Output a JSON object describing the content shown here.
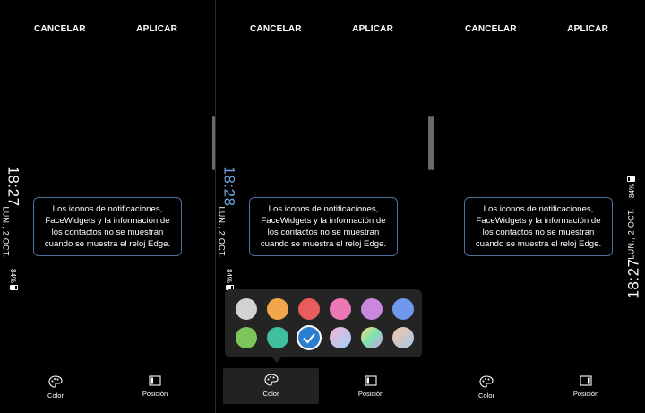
{
  "header": {
    "cancel_label": "CANCELAR",
    "apply_label": "APLICAR"
  },
  "notice_text": "Los iconos de notificaciones,\nFaceWidgets y la información de\nlos contactos no se muestran\ncuando se muestra el reloj Edge.",
  "bottom": {
    "color_label": "Color",
    "position_label": "Posición"
  },
  "panels": [
    {
      "time": "18:27",
      "date": "LUN., 2 OCT.",
      "battery": "84%",
      "clock_color": "#ffffff",
      "orientation": "left"
    },
    {
      "time": "18:28",
      "date": "LUN., 2 OCT.",
      "battery": "84%",
      "clock_color": "#6fa3d8",
      "orientation": "left"
    },
    {
      "time": "18:27",
      "date": "LUN., 2 OCT.",
      "battery": "84%",
      "clock_color": "#ffffff",
      "orientation": "right"
    }
  ],
  "palette": {
    "selected": "teal-blue",
    "swatches": [
      {
        "name": "light-gray",
        "color": "#d2d2d2"
      },
      {
        "name": "orange",
        "color": "#f0a64a"
      },
      {
        "name": "red",
        "color": "#e85c5c"
      },
      {
        "name": "pink",
        "color": "#ec79b5"
      },
      {
        "name": "violet",
        "color": "#c987e0"
      },
      {
        "name": "blue",
        "color": "#6f97ec"
      },
      {
        "name": "green",
        "color": "#7cc55a"
      },
      {
        "name": "teal",
        "color": "#3fbf9e"
      },
      {
        "name": "teal-blue",
        "color": "#2b7fcf"
      },
      {
        "name": "gradient-pastel-1",
        "color": "linear-gradient(135deg,#f7b3d7,#9fd0f5)"
      },
      {
        "name": "gradient-pastel-2",
        "color": "linear-gradient(135deg,#f8e27a,#7fe0b0,#d19cf2)"
      },
      {
        "name": "gradient-pastel-3",
        "color": "linear-gradient(135deg,#f5c6a2,#a7c8f0)"
      }
    ]
  }
}
